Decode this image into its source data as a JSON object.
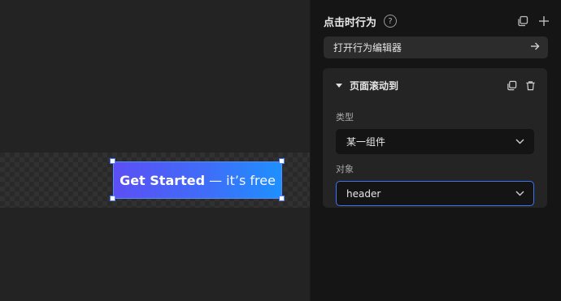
{
  "canvas": {
    "cta": {
      "strong_text": "Get Started",
      "light_text": "— it’s free"
    }
  },
  "panel": {
    "title": "点击时行为",
    "help_glyph": "?",
    "open_editor_label": "打开行为编辑器",
    "action_card": {
      "title": "页面滚动到",
      "fields": {
        "type_label": "类型",
        "type_value": "某一组件",
        "target_label": "对象",
        "target_value": "header"
      }
    }
  },
  "icons": {
    "help": "question-circle-icon",
    "copy_header": "copy-icon",
    "add": "plus-icon",
    "arrow": "arrow-right-icon",
    "duplicate": "duplicate-icon",
    "delete": "trash-icon",
    "caret": "caret-down-icon",
    "chevron": "chevron-down-icon"
  },
  "colors": {
    "accent_blue": "#3e73f5",
    "cta_gradient_start": "#5b4ff5",
    "cta_gradient_end": "#1e90ff",
    "panel_bg": "#151515"
  }
}
